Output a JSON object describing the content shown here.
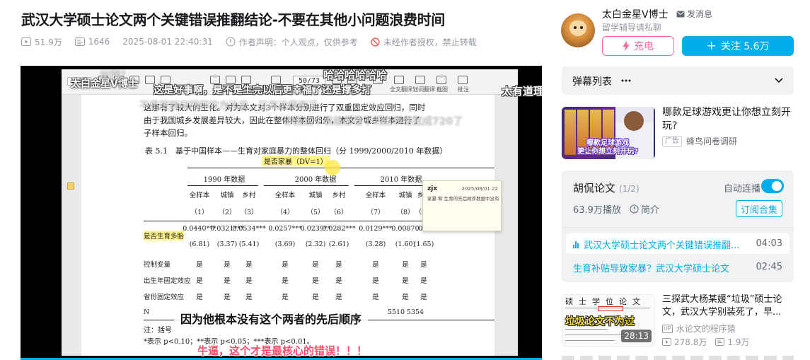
{
  "video": {
    "title": "武汉大学硕士论文两个关键错误推翻结论-不要在其他小问题浪费时间",
    "views": "51.9万",
    "danmaku_count": "1646",
    "publish_time": "2025-08-01 22:40:31",
    "author_statement": "作者声明：个人观点，仅供参考",
    "no_repost": "未经作者授权，禁止转载"
  },
  "player": {
    "uploader_watermark": "太白金星V博士",
    "subtitle": "因为他根本没有这个两者的先后顺序",
    "danmaku": [
      {
        "text": "出院！",
        "style": "faded"
      },
      {
        "text": "哈哈哈哈哈哈",
        "style": "white"
      },
      {
        "text": "太有道理",
        "style": "white"
      },
      {
        "text": "这是好事啊，是不是生完以后更幸福了还是撑多打",
        "style": "white"
      },
      {
        "text": "不是更想用同样的方法说，又高达很高了",
        "style": "faded"
      },
      {
        "text": "你连这个表格都看不明白表格就成720了",
        "style": "faded"
      },
      {
        "text": "牛逼，这个才是最核心的错误！！！",
        "style": "red"
      }
    ],
    "pdf": {
      "zoom": "118%",
      "page": "50/73",
      "toolbar_right": [
        "全文翻译",
        "划词翻译",
        "截图",
        "批注"
      ],
      "paragraph": [
        "这那有了较大的生化。对为本文对3个样本分别进行了双重固定效应回归，同时",
        "由于我国城乡发展差异较大，因此在整体样本回归外，本文分城乡样本进行了",
        "子样本回归。"
      ],
      "table_caption": "表 5.1　基于中国样本——生育对家庭暴力的整体回归（分 1999/2000/2010 年数据）",
      "dependent_var": "是否家暴（DV=1）",
      "year_groups": [
        "1990 年数据",
        "2000 年数据",
        "2010 年数据"
      ],
      "col_types": [
        "全样本",
        "城镇",
        "乡村",
        "全样本",
        "城镇",
        "乡村",
        "全样本",
        "城镇",
        "乡村"
      ],
      "col_nums": [
        "（1）",
        "（2）",
        "（3）",
        "（4）",
        "（5）",
        "（6）",
        "（7）",
        "（8）",
        "（9）"
      ],
      "row_label": "是否生育多胎",
      "coefs": [
        "0.0440***",
        "0.0321***",
        "0.0534***",
        "0.0257***",
        "0.0239**",
        "0.0282***",
        "0.0129***",
        "0.00870",
        "0.0"
      ],
      "tstats": [
        "(6.81)",
        "(3.37)",
        "(5.41)",
        "(3.69)",
        "(2.32)",
        "(2.61)",
        "(3.28)",
        "(1.60)",
        "(1.65)"
      ],
      "control_rows": [
        {
          "label": "控制变量",
          "values": [
            "是",
            "是",
            "是",
            "是",
            "是",
            "是",
            "是",
            "是",
            "是"
          ]
        },
        {
          "label": "出生年固定效应",
          "values": [
            "是",
            "是",
            "是",
            "是",
            "是",
            "是",
            "是",
            "是",
            "是"
          ]
        },
        {
          "label": "省份固定效应",
          "values": [
            "是",
            "是",
            "是",
            "是",
            "是",
            "是",
            "是",
            "是",
            "是"
          ]
        }
      ],
      "n_label": "N",
      "n_values": [
        "5510",
        "5354"
      ],
      "note1": "注：括号",
      "note2": "*表示 p<0.10；**表示 p<0.05；***表示 p<0.01。",
      "comment_popup": {
        "user": "zjx",
        "time": "2025/08/01 22",
        "body": "家暴 和 生育的先后顺序数据中没有给出"
      }
    }
  },
  "uploader": {
    "name": "太白金星V博士",
    "message": "发消息",
    "description": "留学辅导请私聊",
    "charge": "充电",
    "follow": "关注 5.6万"
  },
  "danmaku_list": {
    "label": "弹幕列表"
  },
  "ad": {
    "title": "哪款足球游戏更让你想立刻开玩?",
    "badge": "广告",
    "source": "蜂鸟问卷调研",
    "thumb_caption": [
      "哪款足球游戏",
      "更让你想立刻开玩?"
    ]
  },
  "series": {
    "title": "胡侃论文",
    "count": "(1/2)",
    "autoplay": "自动连播",
    "plays": "63.9万播放",
    "intro": "简介",
    "subscribe": "订阅合集",
    "episodes": [
      {
        "title": "武汉大学硕士论文两个关键错误推翻...",
        "duration": "04:03",
        "active": true
      },
      {
        "title": "生育补贴导致家暴？武汉大学硕士论文",
        "duration": "02:45",
        "active": false
      }
    ]
  },
  "recommendation": {
    "title": "三探武大杨某媛“垃圾”硕士论文，武汉大学别装死了，早...",
    "uploader": "水论文的程序猿",
    "views": "278.8万",
    "danmaku": "1.9万",
    "duration": "28:13",
    "thumb_caption": "垃圾论文不为过",
    "thumb_head": "硕士学位论文"
  },
  "colors": {
    "accent": "#00aeec",
    "pink": "#ff6699",
    "text": "#18191c",
    "muted": "#9499a0"
  }
}
